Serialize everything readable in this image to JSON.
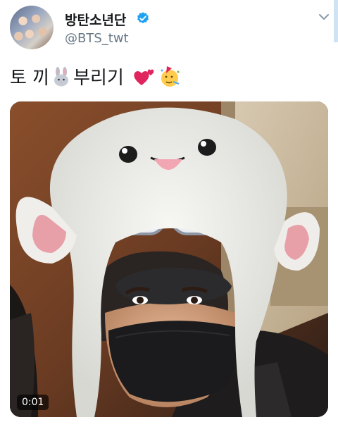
{
  "author": {
    "display_name": "방탄소년단",
    "handle": "@BTS_twt",
    "verified": true
  },
  "tweet": {
    "text_part1": "토 끼",
    "text_part2": "부리기",
    "emojis": [
      "rabbit-face",
      "two-hearts",
      "partying-face"
    ]
  },
  "video": {
    "duration": "0:01"
  },
  "colors": {
    "verified_blue": "#1da1f2",
    "handle_gray": "#657786"
  }
}
